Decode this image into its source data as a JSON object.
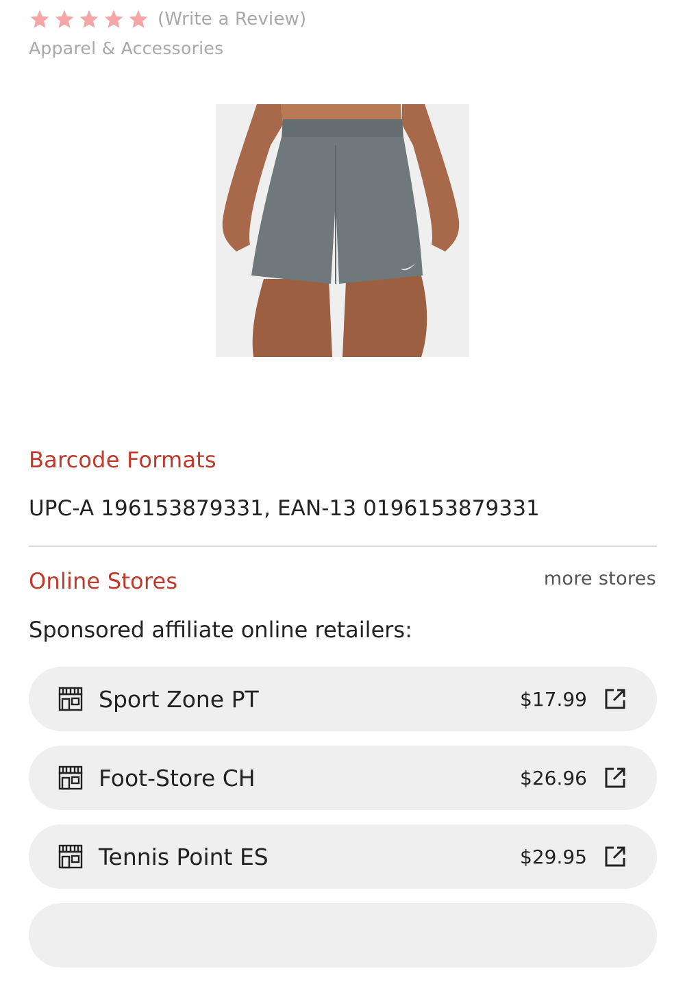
{
  "rating": {
    "star_count": 5,
    "star_color": "#f4a5a5",
    "review_link": "(Write a Review)"
  },
  "category": "Apparel & Accessories",
  "product_image": {
    "icon": "product-photo-shorts"
  },
  "barcode": {
    "title": "Barcode Formats",
    "text": "UPC-A 196153879331, EAN-13 0196153879331"
  },
  "online_stores": {
    "title": "Online Stores",
    "more_link": "more stores",
    "subtitle": "Sponsored affiliate online retailers:",
    "stores": [
      {
        "name": "Sport Zone PT",
        "price": "$17.99",
        "icon": "store-icon"
      },
      {
        "name": "Foot-Store CH",
        "price": "$26.96",
        "icon": "store-icon"
      },
      {
        "name": "Tennis Point ES",
        "price": "$29.95",
        "icon": "store-icon"
      }
    ]
  },
  "colors": {
    "accent": "#c0392b",
    "row_bg": "#efefef",
    "muted": "#a8a8a8"
  }
}
